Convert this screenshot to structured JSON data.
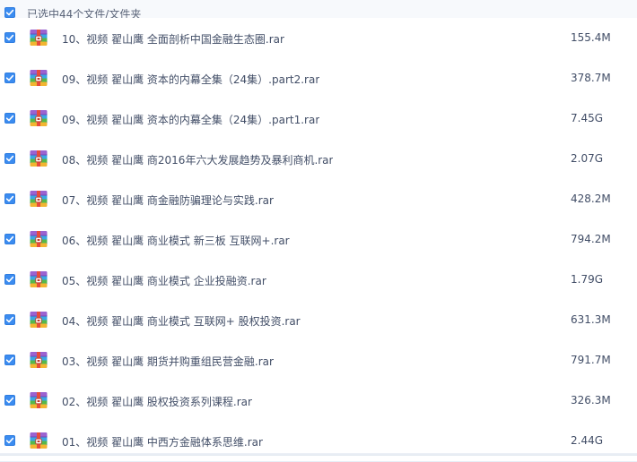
{
  "header": {
    "selection_text": "已选中44个文件/文件夹",
    "checked": true
  },
  "icons": {
    "checkbox": "checkbox-checked-icon",
    "file_type": "rar-archive-icon"
  },
  "colors": {
    "checkbox_blue": "#3b8cf0",
    "text": "#424e67",
    "row_divider": "#e8eef6",
    "header_bg": "#f7f9fc"
  },
  "files": [
    {
      "name": "10、视频 翟山鹰 全面剖析中国金融生态圈.rar",
      "size": "155.4M",
      "checked": true
    },
    {
      "name": "09、视频 翟山鹰 资本的内幕全集（24集）.part2.rar",
      "size": "378.7M",
      "checked": true
    },
    {
      "name": "09、视频 翟山鹰 资本的内幕全集（24集）.part1.rar",
      "size": "7.45G",
      "checked": true
    },
    {
      "name": "08、视频 翟山鹰 商2016年六大发展趋势及暴利商机.rar",
      "size": "2.07G",
      "checked": true
    },
    {
      "name": "07、视频 翟山鹰 商金融防骗理论与实践.rar",
      "size": "428.2M",
      "checked": true
    },
    {
      "name": "06、视频 翟山鹰 商业模式 新三板 互联网+.rar",
      "size": "794.2M",
      "checked": true
    },
    {
      "name": "05、视频 翟山鹰 商业模式 企业投融资.rar",
      "size": "1.79G",
      "checked": true
    },
    {
      "name": "04、视频 翟山鹰 商业模式 互联网+ 股权投资.rar",
      "size": "631.3M",
      "checked": true
    },
    {
      "name": "03、视频 翟山鹰 期货并购重组民营金融.rar",
      "size": "791.7M",
      "checked": true
    },
    {
      "name": "02、视频 翟山鹰 股权投资系列课程.rar",
      "size": "326.3M",
      "checked": true
    },
    {
      "name": "01、视频 翟山鹰 中西方金融体系思维.rar",
      "size": "2.44G",
      "checked": true
    }
  ]
}
